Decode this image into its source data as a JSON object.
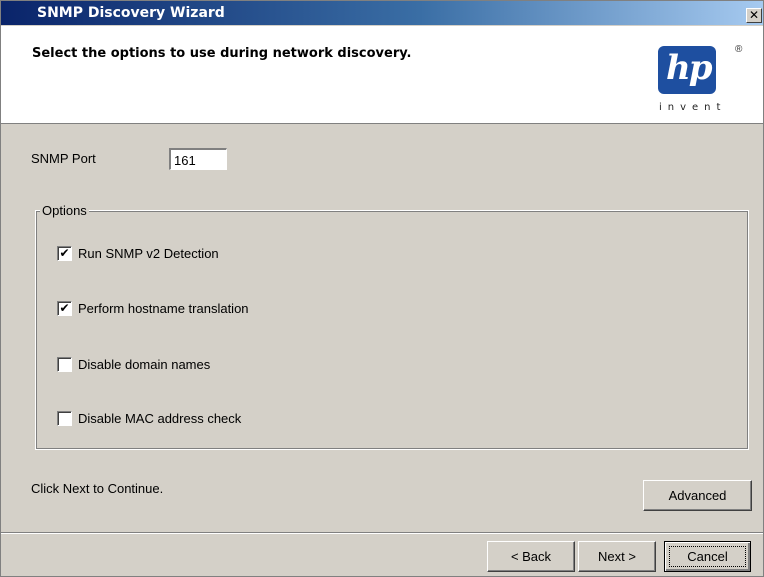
{
  "window": {
    "title": "SNMP Discovery Wizard",
    "close_glyph": "✕"
  },
  "header": {
    "subtitle": "Select the options to use during network discovery.",
    "logo": {
      "mark": "hp",
      "registered": "®",
      "tagline": "invent",
      "color": "#1e4fa0"
    }
  },
  "port": {
    "label": "SNMP Port",
    "value": "161"
  },
  "options": {
    "legend": "Options",
    "items": [
      {
        "label": "Run SNMP v2 Detection",
        "checked": true,
        "mark": "✔"
      },
      {
        "label": "Perform hostname translation",
        "checked": true,
        "mark": "✔"
      },
      {
        "label": "Disable domain names",
        "checked": false,
        "mark": ""
      },
      {
        "label": "Disable MAC address check",
        "checked": false,
        "mark": ""
      }
    ]
  },
  "footer": {
    "hint": "Click Next to Continue.",
    "advanced_label": "Advanced",
    "back_label": "< Back",
    "next_label": "Next >",
    "cancel_label": "Cancel"
  }
}
